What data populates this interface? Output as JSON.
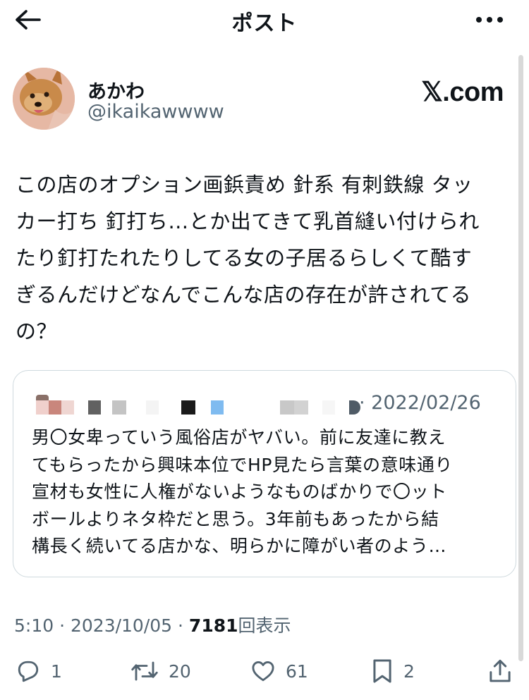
{
  "header": {
    "title": "ポスト",
    "back_icon": "arrow-left-icon",
    "more_icon": "more-dots-icon"
  },
  "author": {
    "name": "あかわ",
    "handle": "@ikaikawwww",
    "badge": "𝕏.com"
  },
  "tweet": {
    "lines": [
      "この店のオプション画鋲責め 針系 有刺鉄線 タッ",
      "カー打ち 釘打ち…とか出てきて乳首縫い付けられ",
      "たり釘打たれたりしてる女の子居るらしくて酷す",
      "ぎるんだけどなんでこんな店の存在が許されてる",
      "の？"
    ]
  },
  "quote": {
    "date": "· 2022/02/26",
    "lines": [
      "男〇女卑っていう風俗店がヤバい。前に友達に教え",
      "てもらったから興味本位でHP見たら言葉の意味通り",
      "宣材も女性に人権がないようなものばかりで〇ット",
      "ボールよりネタ枠だと思う。3年前もあったから結",
      "構長く続いてる店かな、明らかに障がい者のよう…"
    ]
  },
  "meta": {
    "time": "5:10 · 2023/10/05 · ",
    "views": "7181",
    "views_label": "回表示"
  },
  "actions": {
    "reply": "1",
    "retweet": "20",
    "like": "61",
    "bookmark": "2"
  },
  "colors": {
    "text": "#0f1419",
    "secondary": "#536471",
    "border": "#cfd9de"
  }
}
